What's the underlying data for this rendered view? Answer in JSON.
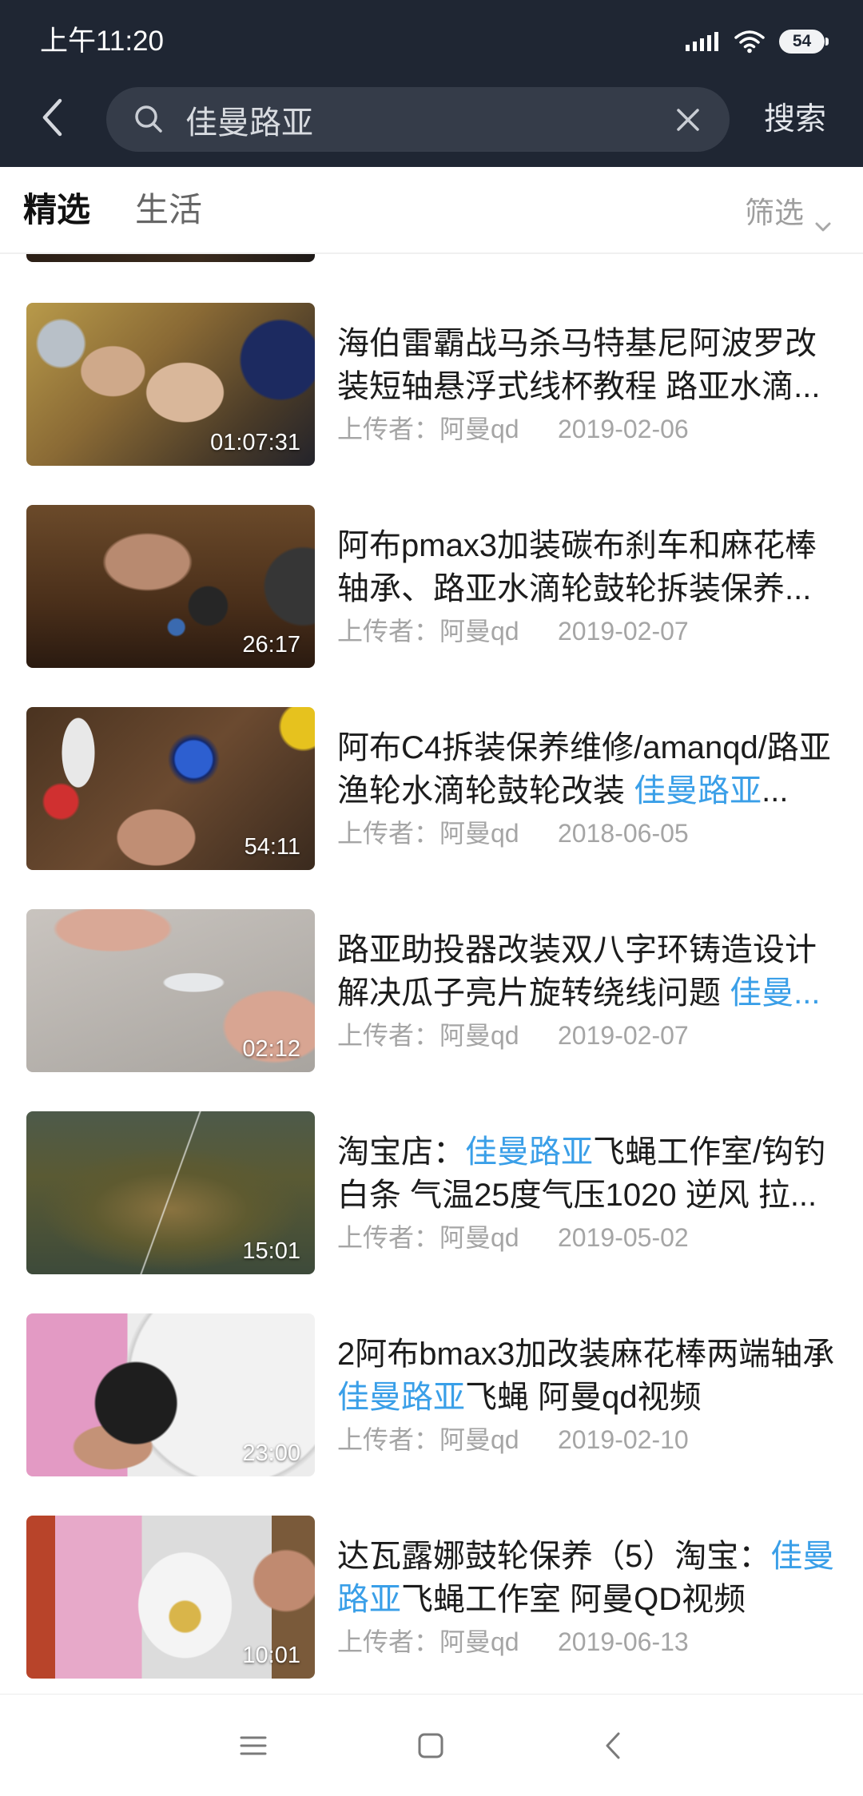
{
  "status_bar": {
    "time": "上午11:20",
    "battery_level": "54",
    "icons": [
      "signal-icon",
      "wifi-icon",
      "battery-icon"
    ]
  },
  "search": {
    "back_icon": "back-icon",
    "search_icon": "search-icon",
    "query": "佳曼路亚",
    "clear_icon": "close-icon",
    "submit_label": "搜索"
  },
  "tabs": [
    {
      "label": "精选",
      "active": true
    },
    {
      "label": "生活",
      "active": false
    }
  ],
  "filter": {
    "label": "筛选",
    "icon": "chevron-down-icon"
  },
  "colors": {
    "header_bg": "#1f2633",
    "search_bg": "#353c49",
    "highlight": "#3a9fe8",
    "title_text": "#1c1c1c",
    "meta_text": "#a5a5a5"
  },
  "videos": [
    {
      "title": [
        {
          "text": "海伯雷霸战马杀马特基尼阿波罗改装短轴悬浮式线杯教程 路亚水滴...",
          "highlight": false
        }
      ],
      "duration": "01:07:31",
      "uploader": "上传者：阿曼qd",
      "date": "2019-02-06"
    },
    {
      "title": [
        {
          "text": "阿布pmax3加装碳布刹车和麻花棒轴承、路亚水滴轮鼓轮拆装保养...",
          "highlight": false
        }
      ],
      "duration": "26:17",
      "uploader": "上传者：阿曼qd",
      "date": "2019-02-07"
    },
    {
      "title": [
        {
          "text": "阿布C4拆装保养维修/amanqd/路亚渔轮水滴轮鼓轮改装 ",
          "highlight": false
        },
        {
          "text": "佳曼路亚",
          "highlight": true
        },
        {
          "text": "...",
          "highlight": false
        }
      ],
      "duration": "54:11",
      "uploader": "上传者：阿曼qd",
      "date": "2018-06-05"
    },
    {
      "title": [
        {
          "text": "路亚助投器改装双八字环铸造设计解决瓜子亮片旋转绕线问题 ",
          "highlight": false
        },
        {
          "text": "佳曼...",
          "highlight": true
        }
      ],
      "duration": "02:12",
      "uploader": "上传者：阿曼qd",
      "date": "2019-02-07"
    },
    {
      "title": [
        {
          "text": "淘宝店：",
          "highlight": false
        },
        {
          "text": "佳曼路亚",
          "highlight": true
        },
        {
          "text": "飞蝇工作室/钩钓白条 气温25度气压1020 逆风 拉...",
          "highlight": false
        }
      ],
      "duration": "15:01",
      "uploader": "上传者：阿曼qd",
      "date": "2019-05-02"
    },
    {
      "title": [
        {
          "text": "2阿布bmax3加改装麻花棒两端轴承 ",
          "highlight": false
        },
        {
          "text": "佳曼路亚",
          "highlight": true
        },
        {
          "text": "飞蝇 阿曼qd视频",
          "highlight": false
        }
      ],
      "duration": "23:00",
      "uploader": "上传者：阿曼qd",
      "date": "2019-02-10"
    },
    {
      "title": [
        {
          "text": "达瓦露娜鼓轮保养（5）淘宝：",
          "highlight": false
        },
        {
          "text": "佳曼路亚",
          "highlight": true
        },
        {
          "text": "飞蝇工作室 阿曼QD视频",
          "highlight": false
        }
      ],
      "duration": "10:01",
      "uploader": "上传者：阿曼qd",
      "date": "2019-06-13"
    }
  ],
  "nav_bar": {
    "icons": [
      "menu-icon",
      "home-icon",
      "back-icon"
    ]
  }
}
